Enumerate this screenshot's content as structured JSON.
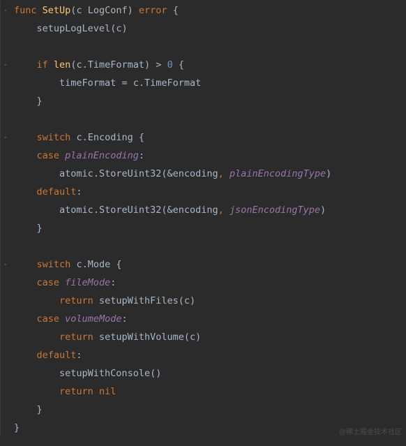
{
  "keywords": {
    "func": "func",
    "if": "if",
    "switch": "switch",
    "case": "case",
    "default": "default",
    "return": "return",
    "nil": "nil",
    "error": "error"
  },
  "identifiers": {
    "setUp": "SetUp",
    "c": "c",
    "logConf": "LogConf",
    "setupLogLevel": "setupLogLevel",
    "len": "len",
    "timeFormat": "TimeFormat",
    "timeFormatVar": "timeFormat",
    "encoding": "Encoding",
    "atomic": "atomic",
    "storeUint32": "StoreUint32",
    "encodingVar": "encoding",
    "mode": "Mode",
    "setupWithFiles": "setupWithFiles",
    "setupWithVolume": "setupWithVolume",
    "setupWithConsole": "setupWithConsole"
  },
  "constants": {
    "plainEncoding": "plainEncoding",
    "plainEncodingType": "plainEncodingType",
    "jsonEncodingType": "jsonEncodingType",
    "fileMode": "fileMode",
    "volumeMode": "volumeMode"
  },
  "numbers": {
    "zero": "0"
  },
  "watermark": "@稀土掘金技术社区",
  "colors": {
    "background": "#2b2b2b",
    "keyword": "#cc7832",
    "funcname": "#ffc66d",
    "number": "#6897bb",
    "constant": "#9876aa",
    "text": "#a9b7c6"
  }
}
